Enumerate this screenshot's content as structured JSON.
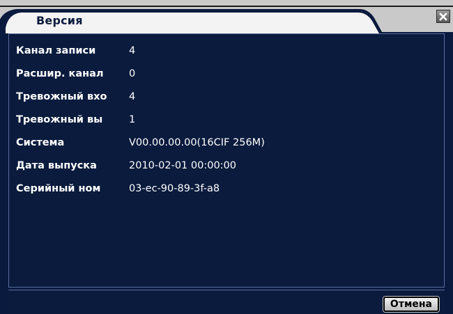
{
  "window": {
    "title": "Версия",
    "close_icon": "close-icon"
  },
  "info": {
    "rows": [
      {
        "label": "Канал записи",
        "value": "4"
      },
      {
        "label": "Расшир. канал",
        "value": "0"
      },
      {
        "label": "Тревожный вхо",
        "value": "4"
      },
      {
        "label": "Тревожный вы",
        "value": "1"
      },
      {
        "label": "Система",
        "value": "V00.00.00.00(16CIF 256M)"
      },
      {
        "label": "Дата выпуска",
        "value": "2010-02-01 00:00:00"
      },
      {
        "label": "Серийный ном",
        "value": "03-ec-90-89-3f-a8"
      }
    ]
  },
  "footer": {
    "cancel_label": "Отмена"
  },
  "colors": {
    "background": "#0a1a3e",
    "title_bar": "#c9c9c9",
    "text": "#ffffff",
    "border": "#5a6e9a"
  }
}
